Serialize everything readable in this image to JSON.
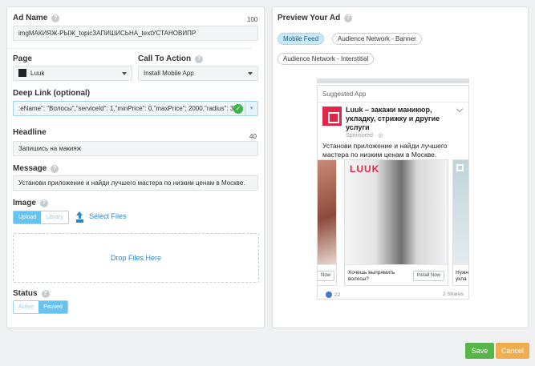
{
  "ad_name": {
    "label": "Ad Name",
    "counter": "100",
    "value": "imgМАКИЯЖ-РЫЖ_topicЗАПИШИСЬНА_textУСТАНОВИПР"
  },
  "page": {
    "label": "Page",
    "value": "Luuk"
  },
  "call_to_action": {
    "label": "Call To Action",
    "value": "Install Mobile App"
  },
  "deep_link": {
    "label": "Deep Link (optional)",
    "value": ":eName\": \"Волосы\",\"serviceId\": 1,\"minPrice\": 0,\"maxPrice\": 2000,\"radius\": 3}"
  },
  "headline": {
    "label": "Headline",
    "counter": "40",
    "value": "Запишись на макияж"
  },
  "message": {
    "label": "Message",
    "value": "Установи приложение и найди лучшего мастера по низким ценам в Москве."
  },
  "image": {
    "label": "Image",
    "upload_label": "Upload",
    "library_label": "Library",
    "select_files_label": "Select Files",
    "drop_label": "Drop Files Here"
  },
  "status": {
    "label": "Status",
    "active_label": "Active",
    "paused_label": "Paused",
    "selected": "Paused"
  },
  "preview": {
    "label": "Preview Your Ad",
    "tabs": [
      "Mobile Feed",
      "Audience Network - Banner",
      "Audience Network - Interstitial"
    ],
    "selected_tab": "Mobile Feed"
  },
  "ad_preview": {
    "suggested": "Suggested App",
    "title": "Luuk – закажи маникюр, укладку, стрижку и другие услуги",
    "sponsored": "Sponsored · ◎",
    "text": "Установи приложение и найди лучшего мастера по низким ценам в Москве.",
    "brand_logo_text": "LUUK",
    "cards": [
      {
        "text": "",
        "button": "Now"
      },
      {
        "text": "Хочешь выпрямить волосы?",
        "button": "Install Now"
      },
      {
        "text": "Нужн укла",
        "button": ""
      }
    ],
    "likes": "22",
    "shares": "2 Shares"
  },
  "actions": {
    "save_label": "Save",
    "cancel_label": "Cancel"
  },
  "colors": {
    "accent_blue": "#66c3ee",
    "link_blue": "#2f86c9",
    "save_green": "#58b548",
    "cancel_orange": "#f0ad4e",
    "brand_red": "#e0274a"
  }
}
